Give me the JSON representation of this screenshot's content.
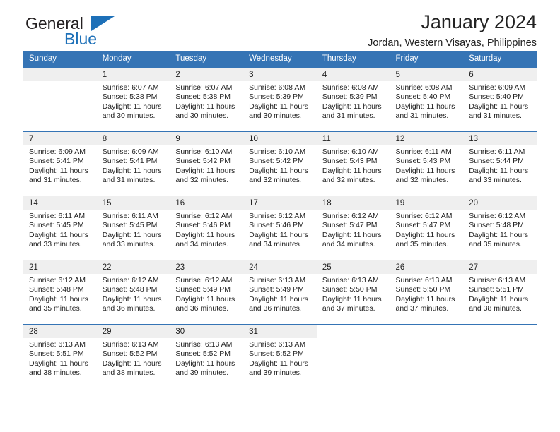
{
  "brand": {
    "name_part1": "General",
    "name_part2": "Blue",
    "triangle_color": "#1d70b8"
  },
  "header": {
    "title": "January 2024",
    "subtitle": "Jordan, Western Visayas, Philippines",
    "header_bg_color": "#3574b5",
    "daynum_bg_color": "#efefef"
  },
  "weekdays": [
    "Sunday",
    "Monday",
    "Tuesday",
    "Wednesday",
    "Thursday",
    "Friday",
    "Saturday"
  ],
  "weeks": [
    [
      {
        "day": "",
        "sunrise": "",
        "sunset": "",
        "daylight_line1": "",
        "daylight_line2": ""
      },
      {
        "day": "1",
        "sunrise": "Sunrise: 6:07 AM",
        "sunset": "Sunset: 5:38 PM",
        "daylight_line1": "Daylight: 11 hours",
        "daylight_line2": "and 30 minutes."
      },
      {
        "day": "2",
        "sunrise": "Sunrise: 6:07 AM",
        "sunset": "Sunset: 5:38 PM",
        "daylight_line1": "Daylight: 11 hours",
        "daylight_line2": "and 30 minutes."
      },
      {
        "day": "3",
        "sunrise": "Sunrise: 6:08 AM",
        "sunset": "Sunset: 5:39 PM",
        "daylight_line1": "Daylight: 11 hours",
        "daylight_line2": "and 30 minutes."
      },
      {
        "day": "4",
        "sunrise": "Sunrise: 6:08 AM",
        "sunset": "Sunset: 5:39 PM",
        "daylight_line1": "Daylight: 11 hours",
        "daylight_line2": "and 31 minutes."
      },
      {
        "day": "5",
        "sunrise": "Sunrise: 6:08 AM",
        "sunset": "Sunset: 5:40 PM",
        "daylight_line1": "Daylight: 11 hours",
        "daylight_line2": "and 31 minutes."
      },
      {
        "day": "6",
        "sunrise": "Sunrise: 6:09 AM",
        "sunset": "Sunset: 5:40 PM",
        "daylight_line1": "Daylight: 11 hours",
        "daylight_line2": "and 31 minutes."
      }
    ],
    [
      {
        "day": "7",
        "sunrise": "Sunrise: 6:09 AM",
        "sunset": "Sunset: 5:41 PM",
        "daylight_line1": "Daylight: 11 hours",
        "daylight_line2": "and 31 minutes."
      },
      {
        "day": "8",
        "sunrise": "Sunrise: 6:09 AM",
        "sunset": "Sunset: 5:41 PM",
        "daylight_line1": "Daylight: 11 hours",
        "daylight_line2": "and 31 minutes."
      },
      {
        "day": "9",
        "sunrise": "Sunrise: 6:10 AM",
        "sunset": "Sunset: 5:42 PM",
        "daylight_line1": "Daylight: 11 hours",
        "daylight_line2": "and 32 minutes."
      },
      {
        "day": "10",
        "sunrise": "Sunrise: 6:10 AM",
        "sunset": "Sunset: 5:42 PM",
        "daylight_line1": "Daylight: 11 hours",
        "daylight_line2": "and 32 minutes."
      },
      {
        "day": "11",
        "sunrise": "Sunrise: 6:10 AM",
        "sunset": "Sunset: 5:43 PM",
        "daylight_line1": "Daylight: 11 hours",
        "daylight_line2": "and 32 minutes."
      },
      {
        "day": "12",
        "sunrise": "Sunrise: 6:11 AM",
        "sunset": "Sunset: 5:43 PM",
        "daylight_line1": "Daylight: 11 hours",
        "daylight_line2": "and 32 minutes."
      },
      {
        "day": "13",
        "sunrise": "Sunrise: 6:11 AM",
        "sunset": "Sunset: 5:44 PM",
        "daylight_line1": "Daylight: 11 hours",
        "daylight_line2": "and 33 minutes."
      }
    ],
    [
      {
        "day": "14",
        "sunrise": "Sunrise: 6:11 AM",
        "sunset": "Sunset: 5:45 PM",
        "daylight_line1": "Daylight: 11 hours",
        "daylight_line2": "and 33 minutes."
      },
      {
        "day": "15",
        "sunrise": "Sunrise: 6:11 AM",
        "sunset": "Sunset: 5:45 PM",
        "daylight_line1": "Daylight: 11 hours",
        "daylight_line2": "and 33 minutes."
      },
      {
        "day": "16",
        "sunrise": "Sunrise: 6:12 AM",
        "sunset": "Sunset: 5:46 PM",
        "daylight_line1": "Daylight: 11 hours",
        "daylight_line2": "and 34 minutes."
      },
      {
        "day": "17",
        "sunrise": "Sunrise: 6:12 AM",
        "sunset": "Sunset: 5:46 PM",
        "daylight_line1": "Daylight: 11 hours",
        "daylight_line2": "and 34 minutes."
      },
      {
        "day": "18",
        "sunrise": "Sunrise: 6:12 AM",
        "sunset": "Sunset: 5:47 PM",
        "daylight_line1": "Daylight: 11 hours",
        "daylight_line2": "and 34 minutes."
      },
      {
        "day": "19",
        "sunrise": "Sunrise: 6:12 AM",
        "sunset": "Sunset: 5:47 PM",
        "daylight_line1": "Daylight: 11 hours",
        "daylight_line2": "and 35 minutes."
      },
      {
        "day": "20",
        "sunrise": "Sunrise: 6:12 AM",
        "sunset": "Sunset: 5:48 PM",
        "daylight_line1": "Daylight: 11 hours",
        "daylight_line2": "and 35 minutes."
      }
    ],
    [
      {
        "day": "21",
        "sunrise": "Sunrise: 6:12 AM",
        "sunset": "Sunset: 5:48 PM",
        "daylight_line1": "Daylight: 11 hours",
        "daylight_line2": "and 35 minutes."
      },
      {
        "day": "22",
        "sunrise": "Sunrise: 6:12 AM",
        "sunset": "Sunset: 5:48 PM",
        "daylight_line1": "Daylight: 11 hours",
        "daylight_line2": "and 36 minutes."
      },
      {
        "day": "23",
        "sunrise": "Sunrise: 6:12 AM",
        "sunset": "Sunset: 5:49 PM",
        "daylight_line1": "Daylight: 11 hours",
        "daylight_line2": "and 36 minutes."
      },
      {
        "day": "24",
        "sunrise": "Sunrise: 6:13 AM",
        "sunset": "Sunset: 5:49 PM",
        "daylight_line1": "Daylight: 11 hours",
        "daylight_line2": "and 36 minutes."
      },
      {
        "day": "25",
        "sunrise": "Sunrise: 6:13 AM",
        "sunset": "Sunset: 5:50 PM",
        "daylight_line1": "Daylight: 11 hours",
        "daylight_line2": "and 37 minutes."
      },
      {
        "day": "26",
        "sunrise": "Sunrise: 6:13 AM",
        "sunset": "Sunset: 5:50 PM",
        "daylight_line1": "Daylight: 11 hours",
        "daylight_line2": "and 37 minutes."
      },
      {
        "day": "27",
        "sunrise": "Sunrise: 6:13 AM",
        "sunset": "Sunset: 5:51 PM",
        "daylight_line1": "Daylight: 11 hours",
        "daylight_line2": "and 38 minutes."
      }
    ],
    [
      {
        "day": "28",
        "sunrise": "Sunrise: 6:13 AM",
        "sunset": "Sunset: 5:51 PM",
        "daylight_line1": "Daylight: 11 hours",
        "daylight_line2": "and 38 minutes."
      },
      {
        "day": "29",
        "sunrise": "Sunrise: 6:13 AM",
        "sunset": "Sunset: 5:52 PM",
        "daylight_line1": "Daylight: 11 hours",
        "daylight_line2": "and 38 minutes."
      },
      {
        "day": "30",
        "sunrise": "Sunrise: 6:13 AM",
        "sunset": "Sunset: 5:52 PM",
        "daylight_line1": "Daylight: 11 hours",
        "daylight_line2": "and 39 minutes."
      },
      {
        "day": "31",
        "sunrise": "Sunrise: 6:13 AM",
        "sunset": "Sunset: 5:52 PM",
        "daylight_line1": "Daylight: 11 hours",
        "daylight_line2": "and 39 minutes."
      },
      {
        "day": "",
        "sunrise": "",
        "sunset": "",
        "daylight_line1": "",
        "daylight_line2": ""
      },
      {
        "day": "",
        "sunrise": "",
        "sunset": "",
        "daylight_line1": "",
        "daylight_line2": ""
      },
      {
        "day": "",
        "sunrise": "",
        "sunset": "",
        "daylight_line1": "",
        "daylight_line2": ""
      }
    ]
  ]
}
